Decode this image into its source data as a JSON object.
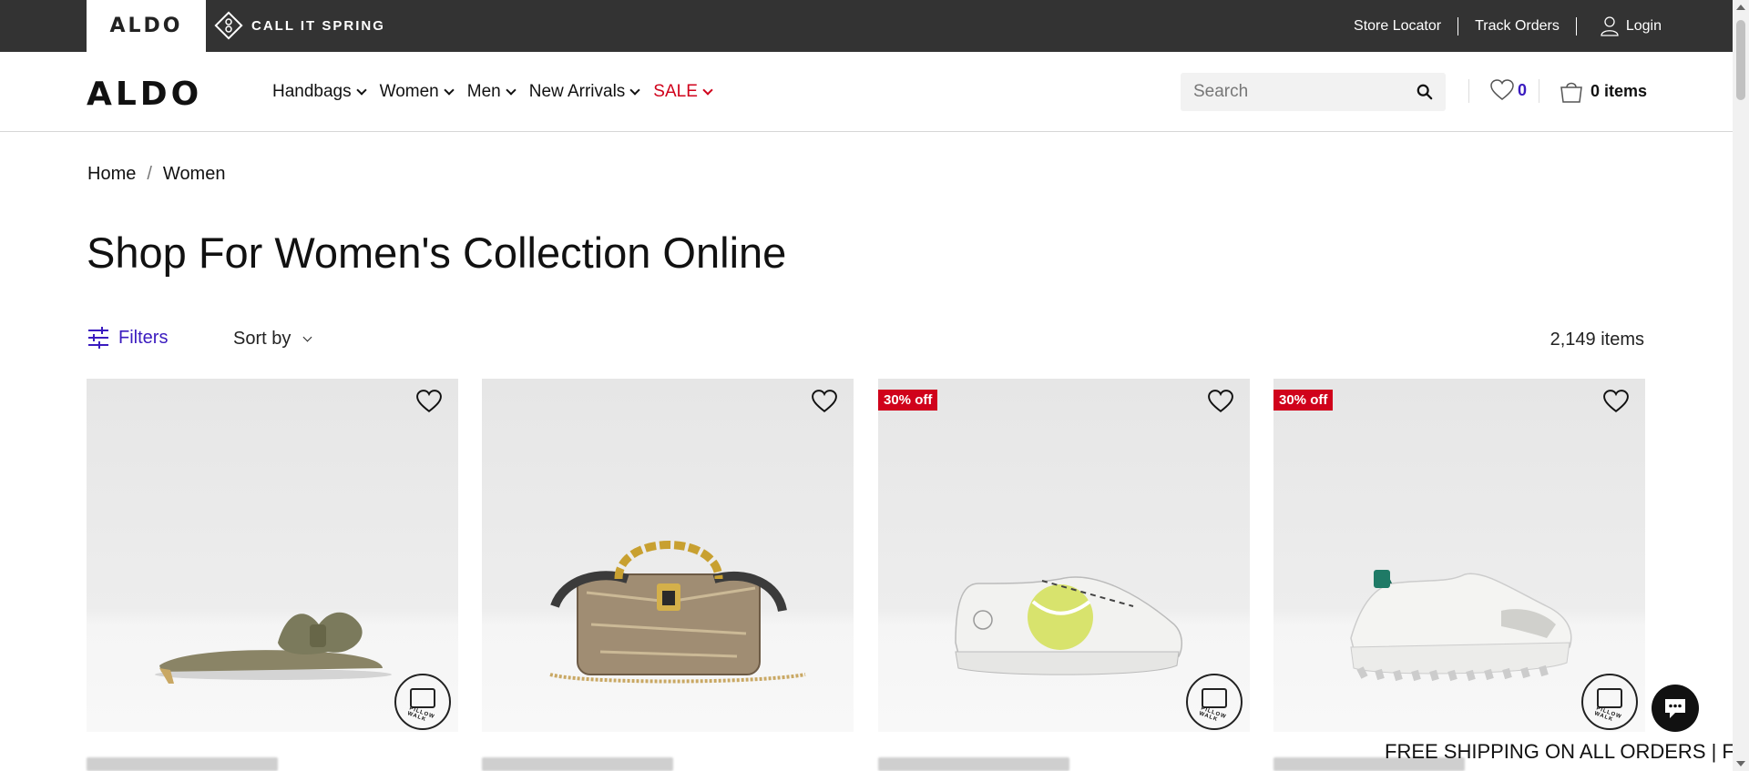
{
  "topbar": {
    "brand_aldo": "ALDO",
    "brand_cis": "CALL IT SPRING",
    "links": {
      "store_locator": "Store Locator",
      "track_orders": "Track Orders",
      "login": "Login"
    }
  },
  "header": {
    "logo": "ALDO",
    "nav": [
      {
        "label": "Handbags"
      },
      {
        "label": "Women"
      },
      {
        "label": "Men"
      },
      {
        "label": "New Arrivals"
      },
      {
        "label": "SALE"
      }
    ],
    "search": {
      "placeholder": "Search",
      "value": ""
    },
    "wishlist_count": "0",
    "cart_label": "0 items"
  },
  "breadcrumb": {
    "home": "Home",
    "separator": "/",
    "current": "Women"
  },
  "page": {
    "title": "Shop For Women's Collection Online",
    "filters_label": "Filters",
    "sort_label": "Sort by",
    "item_count": "2,149 items"
  },
  "products": [
    {
      "badge": "",
      "pillow_walk": true,
      "icon": "sandal-image"
    },
    {
      "badge": "",
      "pillow_walk": false,
      "icon": "handbag-image"
    },
    {
      "badge": "30% off",
      "pillow_walk": true,
      "icon": "sneaker-image"
    },
    {
      "badge": "30% off",
      "pillow_walk": true,
      "icon": "sneaker-image"
    }
  ],
  "pillow_walk_text": "PILLOW WALK",
  "shipping_banner": "FREE SHIPPING ON ALL ORDERS | FR",
  "colors": {
    "topbar_bg": "#333333",
    "accent_purple": "#3a1bbf",
    "sale_red": "#d0021b"
  }
}
